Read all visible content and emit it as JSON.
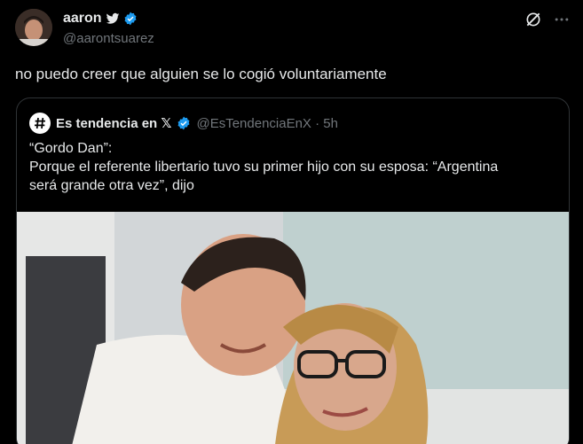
{
  "author": {
    "name": "aaron",
    "handle": "@aarontsuarez"
  },
  "tweet": {
    "text": "no puedo creer que alguien se lo cogió voluntariamente"
  },
  "quote": {
    "name": "Es tendencia en 𝕏",
    "handle_time": "@EsTendenciaEnX · 5h",
    "lines": [
      "“Gordo Dan”:",
      "Porque el referente libertario tuvo su primer hijo con su esposa: “Argentina",
      "será grande otra vez”, dijo"
    ]
  },
  "icons": {
    "bird": "bird-icon",
    "verified": "verified-badge-icon",
    "grok": "grok-icon",
    "more": "more-icon",
    "hashtag": "hashtag-icon"
  },
  "colors": {
    "verified": "#1d9bf0",
    "secondary_text": "#71767b",
    "border": "#2f3336"
  }
}
